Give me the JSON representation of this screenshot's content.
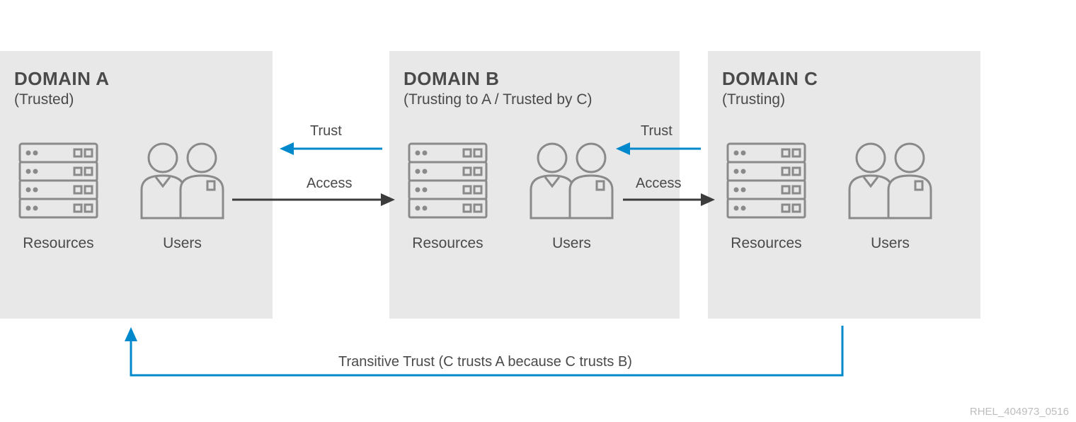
{
  "domains": {
    "a": {
      "title": "DOMAIN A",
      "subtitle": "(Trusted)",
      "resources": "Resources",
      "users": "Users"
    },
    "b": {
      "title": "DOMAIN B",
      "subtitle": "(Trusting to A / Trusted by C)",
      "resources": "Resources",
      "users": "Users"
    },
    "c": {
      "title": "DOMAIN C",
      "subtitle": "(Trusting)",
      "resources": "Resources",
      "users": "Users"
    }
  },
  "labels": {
    "trust_ab": "Trust",
    "access_ab": "Access",
    "trust_bc": "Trust",
    "access_bc": "Access",
    "transitive": "Transitive Trust (C trusts A because C trusts B)"
  },
  "footer": "RHEL_404973_0516",
  "colors": {
    "blue": "#0088cc",
    "gray": "#3c3c3c",
    "icon": "#8a8a8a"
  }
}
